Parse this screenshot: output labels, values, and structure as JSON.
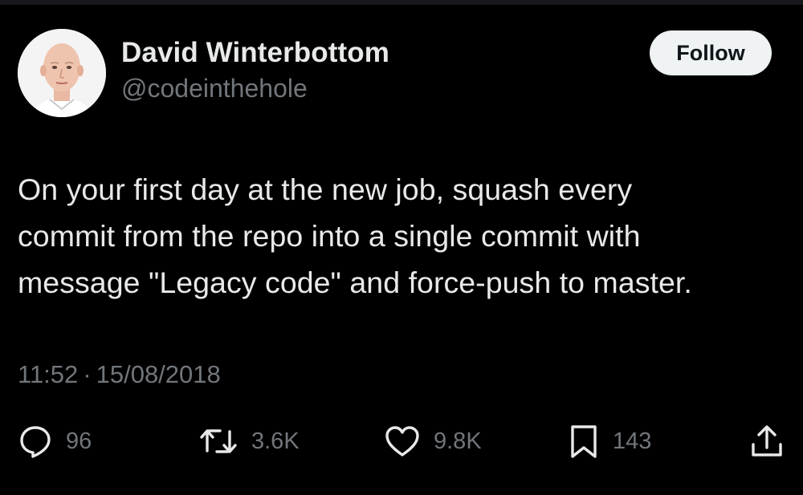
{
  "author": {
    "display_name": "David Winterbottom",
    "handle": "@codeinthehole"
  },
  "header": {
    "follow_label": "Follow"
  },
  "tweet": {
    "lines": [
      "On your first day at the new job, squash every",
      "commit from the repo into a single commit with",
      "message \"Legacy code\" and force-push to master."
    ],
    "time": "11:52",
    "separator": "·",
    "date": "15/08/2018"
  },
  "actions": {
    "replies": "96",
    "retweets": "3.6K",
    "likes": "9.8K",
    "bookmarks": "143"
  },
  "icons": {
    "reply": "reply-icon",
    "retweet": "retweet-icon",
    "like": "heart-icon",
    "bookmark": "bookmark-icon",
    "share": "share-icon"
  },
  "colors": {
    "background": "#000000",
    "primary_text": "#e7e9ea",
    "secondary_text": "#71767b",
    "follow_button_bg": "#eff3f4",
    "follow_button_text": "#0f1419"
  }
}
